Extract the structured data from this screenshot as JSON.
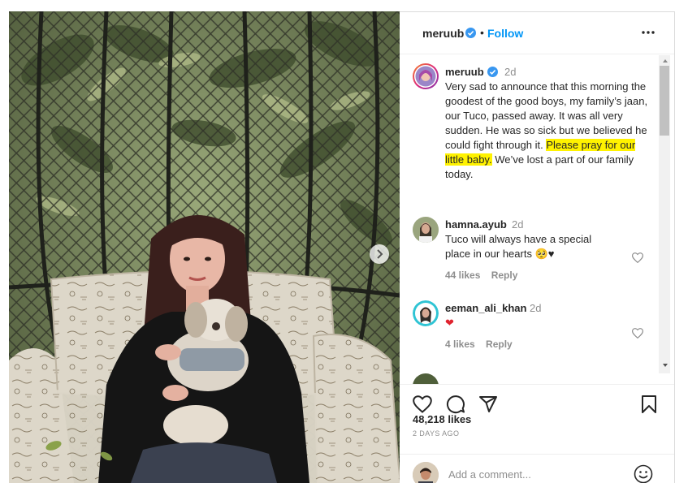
{
  "post": {
    "username": "meruub",
    "dot": "•",
    "follow_label": "Follow",
    "caption": {
      "time": "2d",
      "text_before": "Very sad to announce that this morning the goodest of the good boys, my family’s jaan, our Tuco, passed away. It was all very sudden. He was so sick but we believed he could fight through it. ",
      "text_highlight": "Please pray for our little baby.",
      "text_after": " We’ve lost a part of our family today."
    },
    "comments": [
      {
        "username": "hamna.ayub",
        "time": "2d",
        "text": "Tuco will always have a special place in our hearts 🥺♥",
        "likes": "44 likes",
        "reply": "Reply"
      },
      {
        "username": "eeman_ali_khan",
        "time": "2d",
        "text": "❤",
        "likes": "4 likes",
        "reply": "Reply"
      }
    ],
    "likes": "48,218 likes",
    "posted": "2 DAYS AGO",
    "add_comment_placeholder": "Add a comment..."
  },
  "icons": {
    "verified": "verified-badge-icon",
    "more": "more-options-icon",
    "like": "heart-icon",
    "comment": "comment-bubble-icon",
    "share": "paper-plane-icon",
    "save": "bookmark-icon",
    "emoji": "smiley-icon",
    "next": "chevron-right-icon"
  },
  "colors": {
    "follow": "#0095f6",
    "verified": "#3897f0",
    "highlight": "#fff200",
    "secondary_text": "#8e8e8e"
  }
}
